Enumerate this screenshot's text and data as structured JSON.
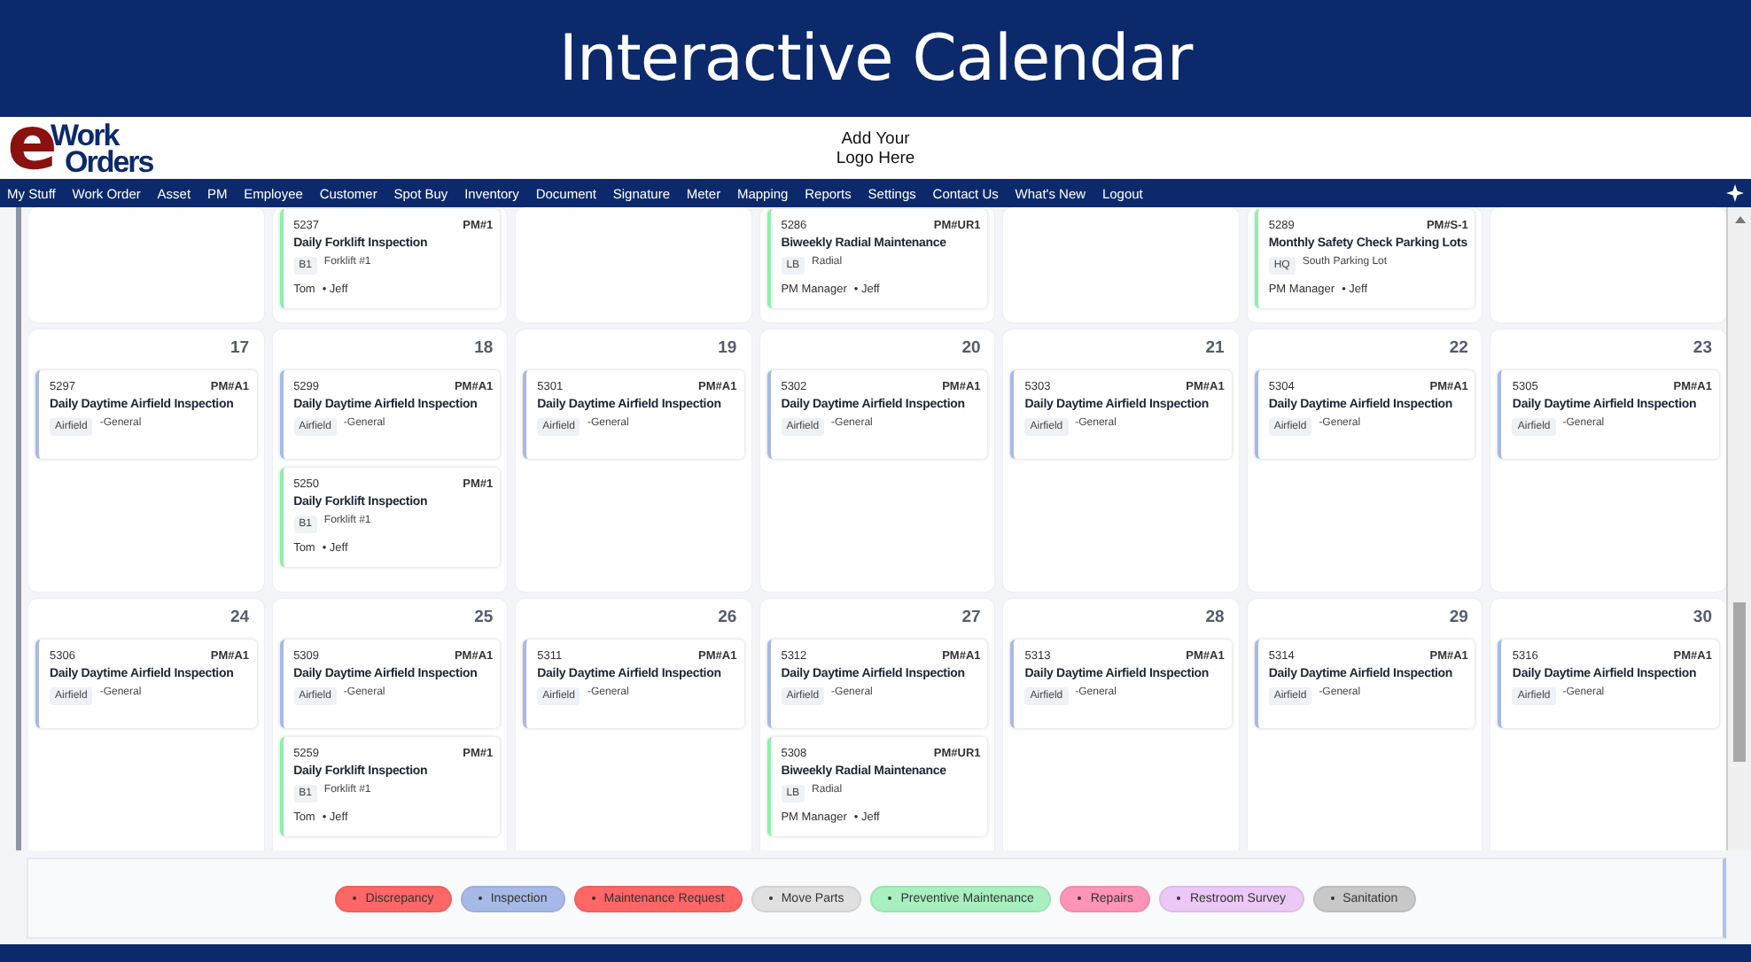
{
  "banner": {
    "title": "Interactive Calendar"
  },
  "header": {
    "logo": {
      "mark": "e",
      "line1": "Work",
      "line2": "Orders"
    },
    "logo_placeholder": "Add Your Logo Here"
  },
  "nav": {
    "items": [
      "My Stuff",
      "Work Order",
      "Asset",
      "PM",
      "Employee",
      "Customer",
      "Spot Buy",
      "Inventory",
      "Document",
      "Signature",
      "Meter",
      "Mapping",
      "Reports",
      "Settings",
      "Contact Us",
      "What's New",
      "Logout"
    ]
  },
  "calendar": {
    "weeks": [
      {
        "days": [
          {
            "kind": "blank"
          },
          {
            "kind": "day",
            "events": [
              {
                "id": "5237",
                "code": "PM#1",
                "title": "Daily Forklift Inspection",
                "tag": "B1",
                "location": "Forklift #1",
                "assignee": "Tom",
                "contact": "• Jeff",
                "color": "#8ef0a8"
              }
            ]
          },
          {
            "kind": "blank"
          },
          {
            "kind": "day",
            "events": [
              {
                "id": "5286",
                "code": "PM#UR1",
                "title": "Biweekly Radial Maintenance",
                "tag": "LB",
                "location": "Radial",
                "assignee": "PM Manager",
                "contact": "• Jeff",
                "color": "#8ef0a8"
              }
            ]
          },
          {
            "kind": "blank"
          },
          {
            "kind": "day",
            "events": [
              {
                "id": "5289",
                "code": "PM#S-1",
                "title": "Monthly Safety Check Parking Lots",
                "tag": "HQ",
                "location": "South Parking Lot",
                "assignee": "PM Manager",
                "contact": "• Jeff",
                "color": "#8ef0a8"
              }
            ]
          },
          {
            "kind": "blank"
          }
        ]
      },
      {
        "days": [
          {
            "kind": "day",
            "number": "17",
            "events": [
              {
                "id": "5297",
                "code": "PM#A1",
                "title": "Daily Daytime Airfield Inspection",
                "tag": "Airfield",
                "location": "-General",
                "color": "#a7b9e6"
              }
            ]
          },
          {
            "kind": "day",
            "number": "18",
            "events": [
              {
                "id": "5299",
                "code": "PM#A1",
                "title": "Daily Daytime Airfield Inspection",
                "tag": "Airfield",
                "location": "-General",
                "color": "#a7b9e6"
              },
              {
                "id": "5250",
                "code": "PM#1",
                "title": "Daily Forklift Inspection",
                "tag": "B1",
                "location": "Forklift #1",
                "assignee": "Tom",
                "contact": "• Jeff",
                "color": "#8ef0a8"
              }
            ]
          },
          {
            "kind": "day",
            "number": "19",
            "events": [
              {
                "id": "5301",
                "code": "PM#A1",
                "title": "Daily Daytime Airfield Inspection",
                "tag": "Airfield",
                "location": "-General",
                "color": "#a7b9e6"
              }
            ]
          },
          {
            "kind": "day",
            "number": "20",
            "events": [
              {
                "id": "5302",
                "code": "PM#A1",
                "title": "Daily Daytime Airfield Inspection",
                "tag": "Airfield",
                "location": "-General",
                "color": "#a7b9e6"
              }
            ]
          },
          {
            "kind": "day",
            "number": "21",
            "events": [
              {
                "id": "5303",
                "code": "PM#A1",
                "title": "Daily Daytime Airfield Inspection",
                "tag": "Airfield",
                "location": "-General",
                "color": "#a7b9e6"
              }
            ]
          },
          {
            "kind": "day",
            "number": "22",
            "events": [
              {
                "id": "5304",
                "code": "PM#A1",
                "title": "Daily Daytime Airfield Inspection",
                "tag": "Airfield",
                "location": "-General",
                "color": "#a7b9e6"
              }
            ]
          },
          {
            "kind": "day",
            "number": "23",
            "events": [
              {
                "id": "5305",
                "code": "PM#A1",
                "title": "Daily Daytime Airfield Inspection",
                "tag": "Airfield",
                "location": "-General",
                "color": "#a7b9e6"
              }
            ]
          }
        ]
      },
      {
        "days": [
          {
            "kind": "day",
            "number": "24",
            "events": [
              {
                "id": "5306",
                "code": "PM#A1",
                "title": "Daily Daytime Airfield Inspection",
                "tag": "Airfield",
                "location": "-General",
                "color": "#a7b9e6"
              }
            ]
          },
          {
            "kind": "day",
            "number": "25",
            "events": [
              {
                "id": "5309",
                "code": "PM#A1",
                "title": "Daily Daytime Airfield Inspection",
                "tag": "Airfield",
                "location": "-General",
                "color": "#a7b9e6"
              },
              {
                "id": "5259",
                "code": "PM#1",
                "title": "Daily Forklift Inspection",
                "tag": "B1",
                "location": "Forklift #1",
                "assignee": "Tom",
                "contact": "• Jeff",
                "color": "#8ef0a8"
              }
            ]
          },
          {
            "kind": "day",
            "number": "26",
            "events": [
              {
                "id": "5311",
                "code": "PM#A1",
                "title": "Daily Daytime Airfield Inspection",
                "tag": "Airfield",
                "location": "-General",
                "color": "#a7b9e6"
              }
            ]
          },
          {
            "kind": "day",
            "number": "27",
            "events": [
              {
                "id": "5312",
                "code": "PM#A1",
                "title": "Daily Daytime Airfield Inspection",
                "tag": "Airfield",
                "location": "-General",
                "color": "#a7b9e6"
              },
              {
                "id": "5308",
                "code": "PM#UR1",
                "title": "Biweekly Radial Maintenance",
                "tag": "LB",
                "location": "Radial",
                "assignee": "PM Manager",
                "contact": "• Jeff",
                "color": "#8ef0a8"
              }
            ]
          },
          {
            "kind": "day",
            "number": "28",
            "events": [
              {
                "id": "5313",
                "code": "PM#A1",
                "title": "Daily Daytime Airfield Inspection",
                "tag": "Airfield",
                "location": "-General",
                "color": "#a7b9e6"
              }
            ]
          },
          {
            "kind": "day",
            "number": "29",
            "events": [
              {
                "id": "5314",
                "code": "PM#A1",
                "title": "Daily Daytime Airfield Inspection",
                "tag": "Airfield",
                "location": "-General",
                "color": "#a7b9e6"
              }
            ]
          },
          {
            "kind": "day",
            "number": "30",
            "events": [
              {
                "id": "5316",
                "code": "PM#A1",
                "title": "Daily Daytime Airfield Inspection",
                "tag": "Airfield",
                "location": "-General",
                "color": "#a7b9e6"
              }
            ]
          }
        ]
      }
    ]
  },
  "legend": {
    "items": [
      {
        "label": "Discrepancy",
        "color": "#ff6666"
      },
      {
        "label": "Inspection",
        "color": "#a7b9e6"
      },
      {
        "label": "Maintenance Request",
        "color": "#ff6666"
      },
      {
        "label": "Move Parts",
        "color": "#e0e0e0"
      },
      {
        "label": "Preventive Maintenance",
        "color": "#a8f0c0"
      },
      {
        "label": "Repairs",
        "color": "#ff94b8"
      },
      {
        "label": "Restroom Survey",
        "color": "#ebc8f5"
      },
      {
        "label": "Sanitation",
        "color": "#c8c8c8"
      }
    ]
  }
}
